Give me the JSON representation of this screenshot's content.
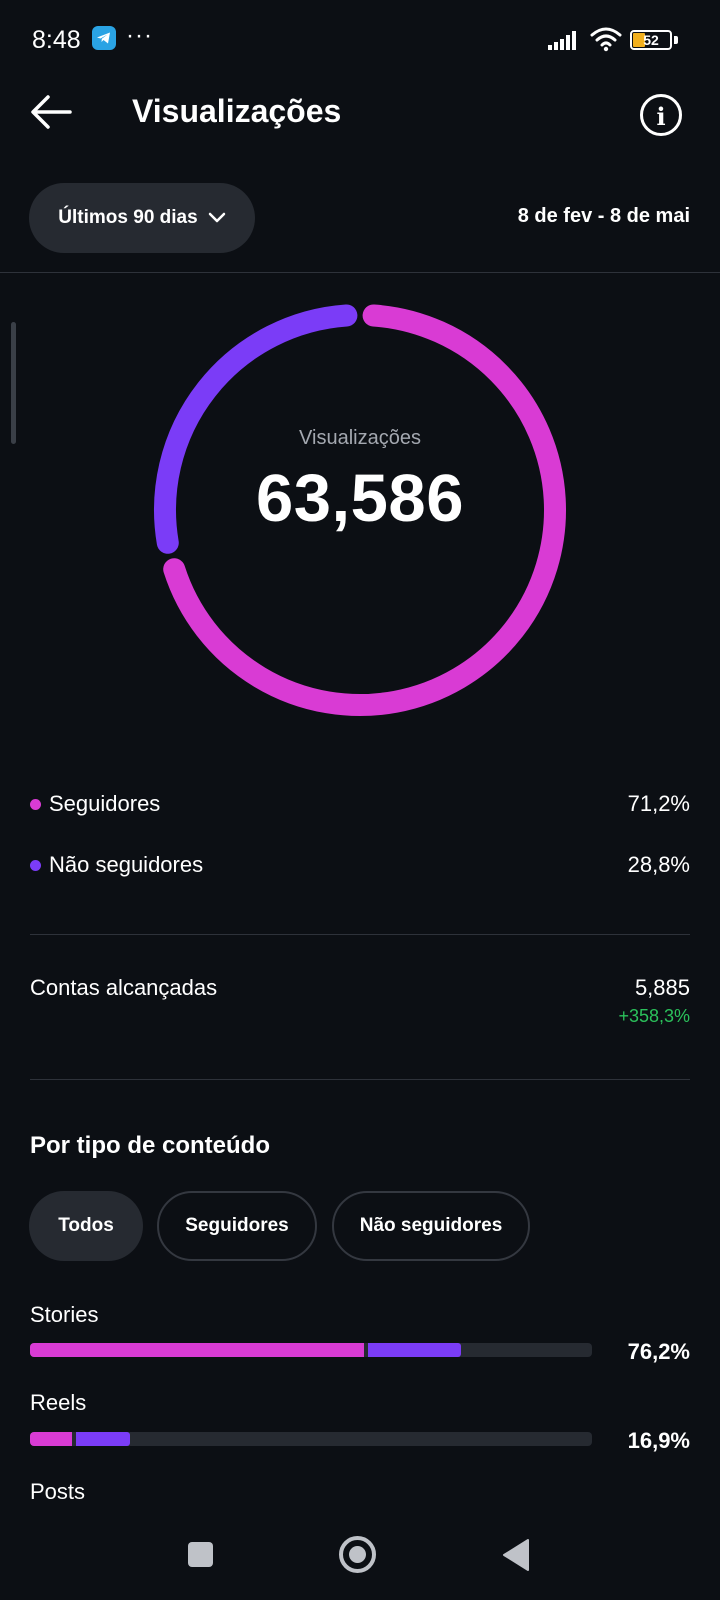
{
  "status_bar": {
    "time": "8:48",
    "more_dots": "···",
    "battery_level": "52",
    "icons": [
      "telegram-icon",
      "signal-icon",
      "wifi-icon",
      "battery-icon"
    ]
  },
  "header": {
    "title": "Visualizações",
    "icons": [
      "arrow-left-icon",
      "info-icon"
    ],
    "info_glyph": "i"
  },
  "filters": {
    "range_label": "Últimos 90 dias",
    "date_range": "8 de fev - 8 de mai"
  },
  "summary": {
    "label": "Visualizações",
    "total": "63,586"
  },
  "breakdown": [
    {
      "label": "Seguidores",
      "value": "71,2%",
      "color": "#d93bd4"
    },
    {
      "label": "Não seguidores",
      "value": "28,8%",
      "color": "#7b3cf7"
    }
  ],
  "reach": {
    "label": "Contas alcançadas",
    "value": "5,885",
    "change": "+358,3%",
    "change_color": "#2bc15b"
  },
  "content_type": {
    "title": "Por tipo de conteúdo",
    "chips": [
      "Todos",
      "Seguidores",
      "Não seguidores"
    ],
    "selected_chip": "Todos",
    "rows": [
      {
        "label": "Stories",
        "value": "76,2%",
        "followers_fraction": 0.595,
        "non_followers_fraction": 0.165
      },
      {
        "label": "Reels",
        "value": "16,9%",
        "followers_fraction": 0.075,
        "non_followers_fraction": 0.095
      },
      {
        "label": "Posts"
      }
    ]
  },
  "nav_bar": {
    "icons": [
      "recent-apps-icon",
      "home-icon",
      "back-icon"
    ]
  },
  "colors": {
    "followers": "#d93bd4",
    "non_followers": "#7b3cf7",
    "background": "#0c0f14",
    "surface": "#262a31"
  }
}
